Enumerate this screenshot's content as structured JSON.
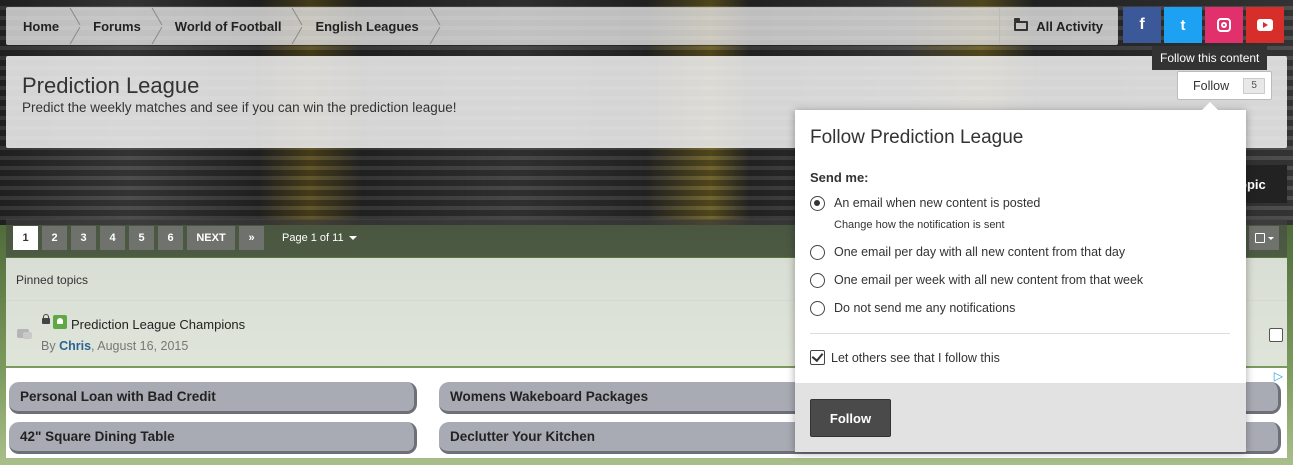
{
  "breadcrumb": {
    "items": [
      {
        "label": "Home"
      },
      {
        "label": "Forums"
      },
      {
        "label": "World of Football"
      },
      {
        "label": "English Leagues"
      }
    ],
    "all_activity": "All Activity"
  },
  "social": {
    "facebook": "f",
    "twitter": "t"
  },
  "header": {
    "title": "Prediction League",
    "description": "Predict the weekly matches and see if you can win the prediction league!",
    "follow_tooltip": "Follow this content",
    "follow_label": "Follow",
    "follow_count": "5",
    "start_topic_partial": "opic"
  },
  "pagination": {
    "pages": [
      "1",
      "2",
      "3",
      "4",
      "5",
      "6"
    ],
    "current": "1",
    "next_label": "NEXT",
    "last_label": "»",
    "page_of": "Page 1 of 11"
  },
  "topics": {
    "pinned_header": "Pinned topics",
    "items": [
      {
        "title": "Prediction League Champions",
        "by": "By ",
        "author": "Chris",
        "date": ", August 16, 2015"
      }
    ]
  },
  "ads": {
    "items": [
      "Personal Loan with Bad Credit",
      "Womens Wakeboard Packages",
      "42\" Square Dining Table",
      "Declutter Your Kitchen"
    ],
    "choices_glyph": "▷"
  },
  "follow_menu": {
    "title": "Follow Prediction League",
    "send_me": "Send me:",
    "options": [
      {
        "label": "An email when new content is posted",
        "selected": true
      },
      {
        "label": "One email per day with all new content from that day",
        "selected": false
      },
      {
        "label": "One email per week with all new content from that week",
        "selected": false
      },
      {
        "label": "Do not send me any notifications",
        "selected": false
      }
    ],
    "change_notification": "Change how the notification is sent",
    "let_others_see": "Let others see that I follow this",
    "follow_button": "Follow"
  },
  "colors": {
    "facebook": "#3b5998",
    "twitter": "#1da1f2",
    "instagram": "#e1306c",
    "youtube": "#d82e2a",
    "pin_green": "#5ea846",
    "author_link": "#2a6496"
  }
}
